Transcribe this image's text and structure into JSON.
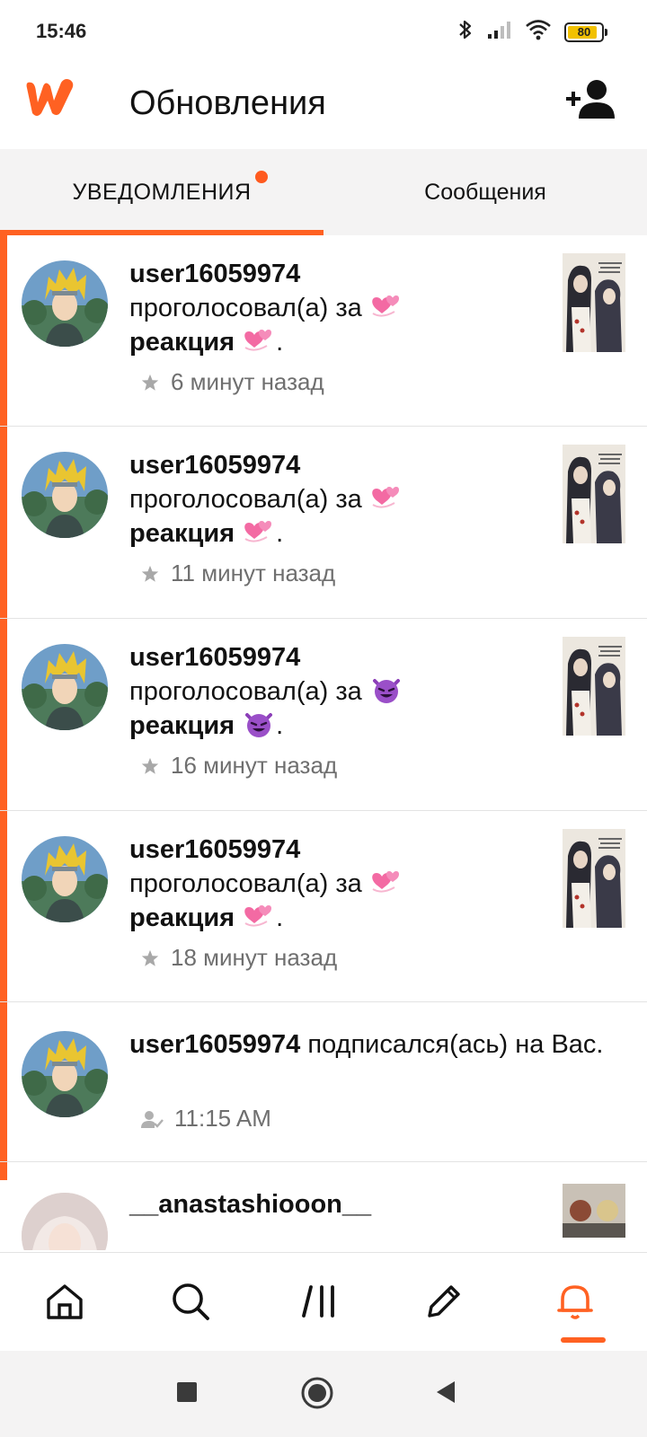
{
  "status_bar": {
    "time": "15:46",
    "battery": "80",
    "battery_level": 0.8,
    "icons": [
      "bluetooth-icon",
      "signal-icon",
      "wifi-icon",
      "battery-icon"
    ]
  },
  "header": {
    "title": "Обновления",
    "add_user_icon": "add-user-icon",
    "logo": "wattpad-logo"
  },
  "tabs": [
    {
      "label": "УВЕДОМЛЕНИЯ",
      "active": true,
      "has_badge": true
    },
    {
      "label": "Сообщения",
      "active": false
    }
  ],
  "notifications": [
    {
      "user": "user16059974",
      "action": "проголосовал(а) за",
      "emoji": "two-hearts",
      "reaction": "реакция",
      "time": "6 минут назад",
      "meta_icon": "star-icon"
    },
    {
      "user": "user16059974",
      "action": "проголосовал(а) за",
      "emoji": "two-hearts",
      "reaction": "реакция",
      "time": "11 минут назад",
      "meta_icon": "star-icon"
    },
    {
      "user": "user16059974",
      "action": "проголосовал(а) за",
      "emoji": "smiling-imp",
      "reaction": "реакция",
      "time": "16 минут назад",
      "meta_icon": "star-icon"
    },
    {
      "user": "user16059974",
      "action": "проголосовал(а) за",
      "emoji": "two-hearts",
      "reaction": "реакция",
      "time": "18 минут назад",
      "meta_icon": "star-icon"
    },
    {
      "user": "user16059974",
      "action": "подписался(ась) на Вас.",
      "time": "11:15 AM",
      "meta_icon": "follow-icon"
    },
    {
      "user": "__anastashiooon__"
    }
  ],
  "colors": {
    "accent": "#ff6122",
    "tab_bg": "#f4f3f3",
    "meta_text": "#6f6f6f"
  },
  "bottom_nav": [
    "home-icon",
    "search-icon",
    "library-icon",
    "write-icon",
    "notifications-icon"
  ],
  "system_nav": [
    "recents-button",
    "home-button",
    "back-button"
  ]
}
